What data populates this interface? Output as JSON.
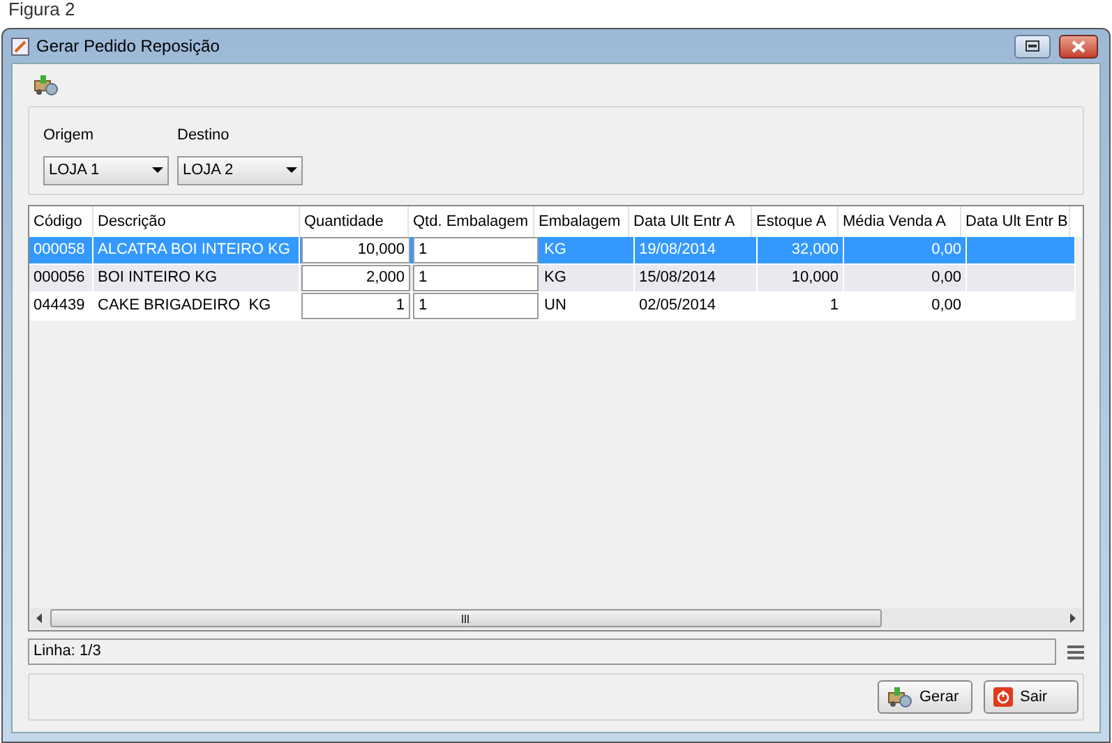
{
  "caption": "Figura 2",
  "window": {
    "title": "Gerar Pedido Reposição"
  },
  "filters": [
    {
      "label": "Origem",
      "value": "LOJA 1"
    },
    {
      "label": "Destino",
      "value": "LOJA 2"
    }
  ],
  "table": {
    "columns": [
      "Código",
      "Descrição",
      "Quantidade",
      "Qtd. Embalagem",
      "Embalagem",
      "Data Ult Entr A",
      "Estoque A",
      "Média Venda A",
      "Data Ult Entr B"
    ],
    "rows": [
      {
        "selected": true,
        "cells": [
          "000058",
          "ALCATRA BOI INTEIRO KG",
          "10,000",
          "1",
          "KG",
          "19/08/2014",
          "32,000",
          "0,00"
        ]
      },
      {
        "selected": false,
        "cells": [
          "000056",
          "BOI INTEIRO KG",
          "2,000",
          "1",
          "KG",
          "15/08/2014",
          "10,000",
          "0,00"
        ]
      },
      {
        "selected": false,
        "cells": [
          "044439",
          "CAKE BRIGADEIRO  KG",
          "1",
          "1",
          "UN",
          "02/05/2014",
          "1",
          "0,00"
        ]
      }
    ]
  },
  "status": "Linha: 1/3",
  "buttons": [
    {
      "kind": "generate",
      "label": "Gerar"
    },
    {
      "kind": "exit",
      "label": "Sair"
    }
  ]
}
